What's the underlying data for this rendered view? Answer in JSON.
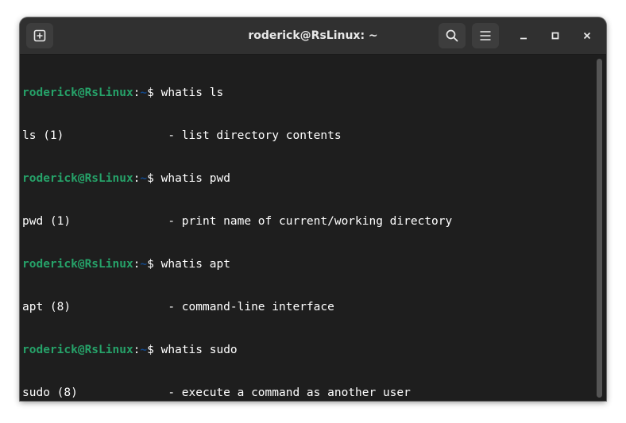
{
  "window": {
    "title": "roderick@RsLinux: ~"
  },
  "header": {
    "new_tab_icon": "new-tab-icon",
    "search_icon": "search-icon",
    "menu_icon": "hamburger-menu-icon",
    "minimize_icon": "minimize-icon",
    "maximize_icon": "maximize-icon",
    "close_icon": "close-icon"
  },
  "terminal": {
    "prompt": {
      "user_host": "roderick@RsLinux",
      "colon": ":",
      "path": "~",
      "symbol": "$ "
    },
    "lines": [
      {
        "type": "prompt",
        "command": "whatis ls"
      },
      {
        "type": "output",
        "text": "ls (1)               - list directory contents"
      },
      {
        "type": "prompt",
        "command": "whatis pwd"
      },
      {
        "type": "output",
        "text": "pwd (1)              - print name of current/working directory"
      },
      {
        "type": "prompt",
        "command": "whatis apt"
      },
      {
        "type": "output",
        "text": "apt (8)              - command-line interface"
      },
      {
        "type": "prompt",
        "command": "whatis sudo"
      },
      {
        "type": "output",
        "text": "sudo (8)             - execute a command as another user"
      },
      {
        "type": "prompt",
        "command": ""
      }
    ]
  },
  "colors": {
    "prompt_user": "#26a269",
    "prompt_path": "#12488b",
    "background": "#1e1e1e",
    "titlebar": "#303030"
  }
}
